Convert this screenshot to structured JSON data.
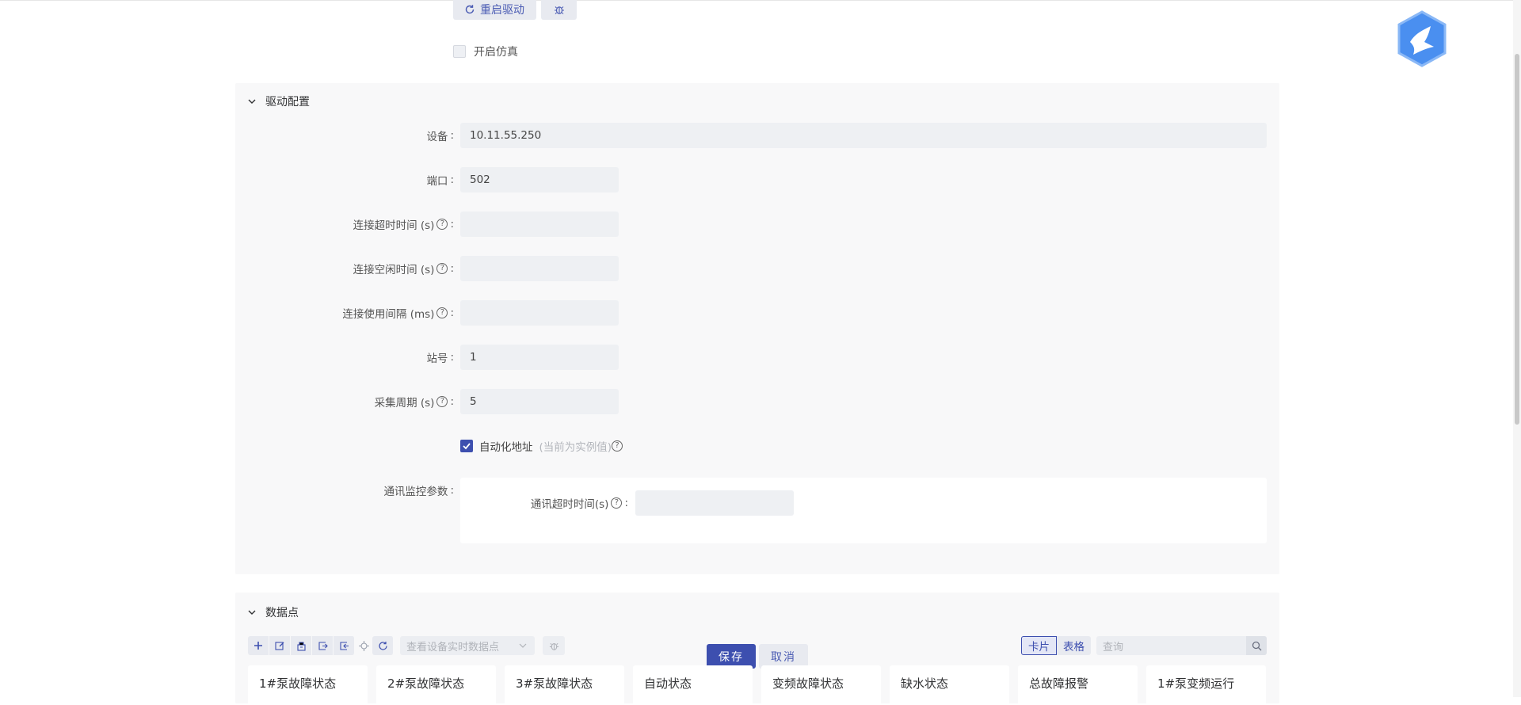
{
  "top": {
    "restart_label": "重启驱动",
    "simulation_label": "开启仿真"
  },
  "driver_panel": {
    "title": "驱动配置",
    "fields": {
      "device": {
        "label": "设备",
        "value": "10.11.55.250"
      },
      "port": {
        "label": "端口",
        "value": "502"
      },
      "conn_timeout": {
        "label": "连接超时时间 (s)",
        "value": ""
      },
      "conn_idle": {
        "label": "连接空闲时间 (s)",
        "value": ""
      },
      "conn_interval": {
        "label": "连接使用间隔 (ms)",
        "value": ""
      },
      "station": {
        "label": "站号",
        "value": "1"
      },
      "collect_period": {
        "label": "采集周期 (s)",
        "value": "5"
      }
    },
    "auto_address": {
      "label": "自动化地址",
      "hint": "(当前为实例值)",
      "checked": true
    },
    "monitor": {
      "label": "通讯监控参数",
      "timeout_label": "通讯超时时间(s)",
      "timeout_value": ""
    },
    "colon": ":"
  },
  "points_panel": {
    "title": "数据点",
    "select_placeholder": "查看设备实时数据点",
    "view_card": "卡片",
    "view_table": "表格",
    "search_placeholder": "查询",
    "cards": [
      "1#泵故障状态",
      "2#泵故障状态",
      "3#泵故障状态",
      "自动状态",
      "变频故障状态",
      "缺水状态",
      "总故障报警",
      "1#泵变频运行"
    ]
  },
  "actions": {
    "save": "保存",
    "cancel": "取消"
  },
  "colors": {
    "primary": "#3d4faf",
    "logo": "#4a8ff0"
  }
}
